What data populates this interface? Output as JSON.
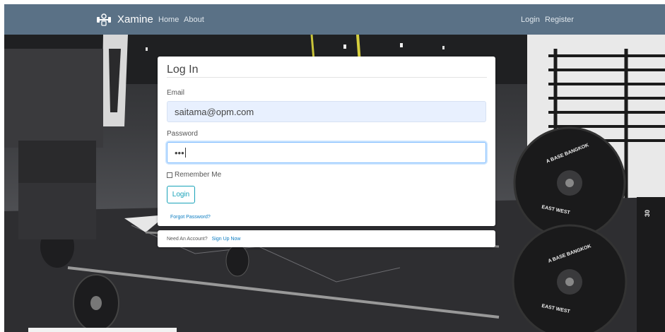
{
  "navbar": {
    "brand": "Xamine",
    "links": {
      "home": "Home",
      "about": "About",
      "login": "Login",
      "register": "Register"
    },
    "logo_icon": "dumbbell-logo-icon"
  },
  "login": {
    "title": "Log In",
    "email_label": "Email",
    "email_value": "saitama@opm.com",
    "password_label": "Password",
    "password_value": "•••",
    "remember_label": "Remember Me",
    "login_button": "Login",
    "forgot_link": "Forgot Password?"
  },
  "footer": {
    "need_account": "Need An Account?",
    "signup_link": "Sign Up Now"
  },
  "background": {
    "plate_text_top": "A BASE BANGKOK",
    "plate_text_side": "EAST WEST",
    "rack_label": "30"
  },
  "colors": {
    "navbar": "#5a7186",
    "accent_info": "#17a2b8",
    "link": "#0d7dc2"
  }
}
